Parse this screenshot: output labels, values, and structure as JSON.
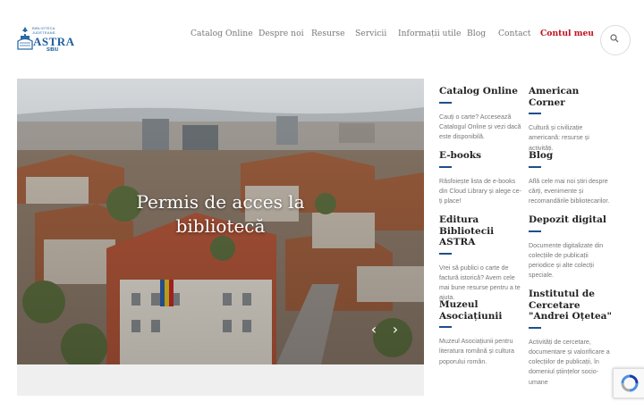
{
  "logo": {
    "small_line1": "BIBLIOTECA",
    "small_line2": "JUDEȚEANĂ",
    "name": "ASTRA",
    "city": "SIBIU"
  },
  "nav": {
    "items": [
      "Catalog Online",
      "Despre noi",
      "Resurse",
      "Servicii",
      "Informații utile",
      "Blog",
      "Contact"
    ],
    "account": "Contul meu"
  },
  "hero": {
    "title_line1": "Permis de acces la",
    "title_line2": "bibliotecă",
    "prev": "‹",
    "next": "›"
  },
  "cards": [
    {
      "title": "Catalog Online",
      "text": "Cauți o carte? Accesează Catalogul Online și vezi dacă este disponibilă."
    },
    {
      "title": "American Corner",
      "text": "Cultură și civilizație americană: resurse și activități."
    },
    {
      "title": "E-books",
      "text": "Răsfoiește lista de e-books din Cloud Library și alege ce-ți place!"
    },
    {
      "title": "Blog",
      "text": "Află cele mai noi știri despre cărți, evenimente și recomandările bibliotecarilor."
    },
    {
      "title": "Editura Bibliotecii ASTRA",
      "text": "Vrei să publici o carte de factură istorică? Avem cele mai bune resurse pentru a te ajuta."
    },
    {
      "title": "Depozit digital",
      "text": "Documente digitalizate din colecțiile de publicații periodice și alte colecții speciale."
    },
    {
      "title": "Muzeul Asociațiunii",
      "text": "Muzeul Asociațiunii pentru literatura română și cultura poporului român."
    },
    {
      "title": "Institutul de Cercetare \"Andrei Oțetea\"",
      "text": "Activități de cercetare, documentare și valorificare a colecțiilor de publicații, în domeniul științelor socio-umane"
    }
  ],
  "colors": {
    "accent": "#c0101f",
    "underline": "#1e4f8a",
    "brand": "#1f5f9e"
  }
}
